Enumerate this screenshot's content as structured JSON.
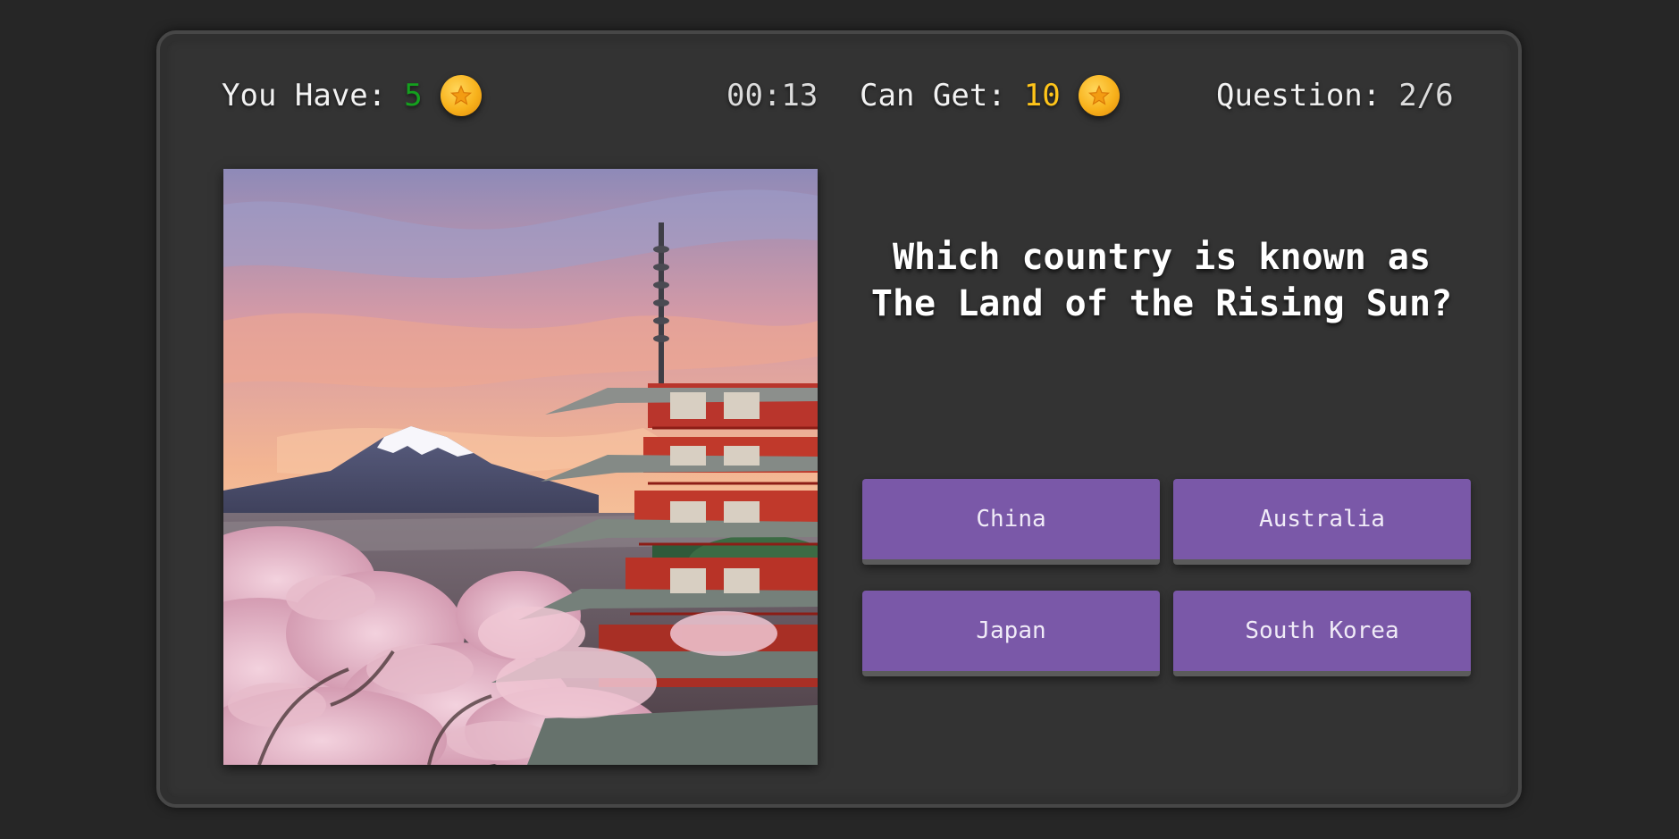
{
  "hud": {
    "you_have_label": "You Have:",
    "you_have_value": "5",
    "timer": "00:13",
    "can_get_label": "Can Get:",
    "can_get_value": "10",
    "question_label": "Question:",
    "question_progress": "2/6",
    "coin_icon": "star-coin-icon"
  },
  "question": {
    "line1": "Which country is known as",
    "line2": "The Land of the Rising Sun?"
  },
  "answers": [
    "China",
    "Australia",
    "Japan",
    "South Korea"
  ],
  "colors": {
    "background": "#262626",
    "panel": "#333333",
    "answer_button": "#7a58a8",
    "coins_owned": "#14a01e",
    "coins_reward": "#ffc51a"
  }
}
